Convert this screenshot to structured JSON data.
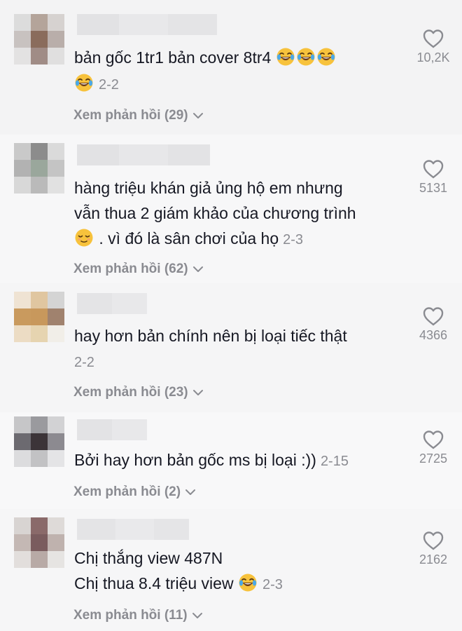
{
  "comments": [
    {
      "lines": [
        "bản gốc 1tr1 bản cover 8tr4"
      ],
      "date": "2-2",
      "replies": "Xem phản hồi (29)",
      "likes": "10,2K"
    },
    {
      "lines": [
        "hàng triệu khán giả ủng hộ em nhưng",
        "vẫn thua 2 giám khảo của chương trình",
        " . vì đó là sân chơi của họ"
      ],
      "date": "2-3",
      "replies": "Xem phản hồi (62)",
      "likes": "5131"
    },
    {
      "lines": [
        "hay hơn bản chính nên bị loại tiếc thật"
      ],
      "date": "2-2",
      "replies": "Xem phản hồi (23)",
      "likes": "4366"
    },
    {
      "lines": [
        "Bởi hay hơn bản gốc ms bị loại :))"
      ],
      "date": "2-15",
      "replies": "Xem phản hồi (2)",
      "likes": "2725"
    },
    {
      "lines": [
        "Chị thắng view 487N",
        "Chị thua 8.4 triệu view"
      ],
      "date": "2-3",
      "replies": "Xem phản hồi (11)",
      "likes": "2162"
    }
  ],
  "icons": {
    "like": "heart-outline-icon",
    "expand": "chevron-down-icon",
    "emoji_laugh": "face-with-tears-of-joy",
    "emoji_relieved": "relieved-face"
  },
  "colors": {
    "text": "#161823",
    "secondary": "#8a8b91",
    "emoji": "#f7c23c"
  }
}
